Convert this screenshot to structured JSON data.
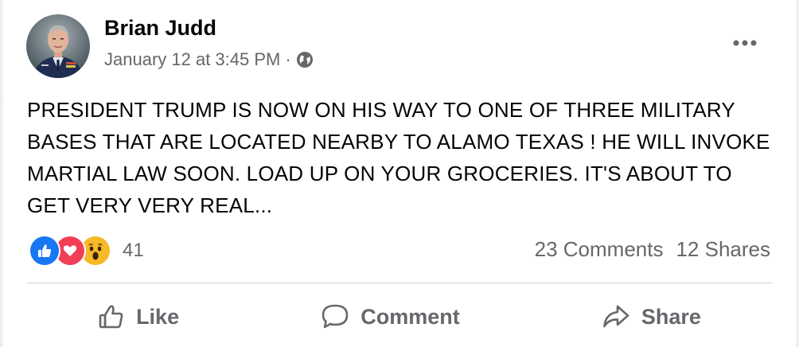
{
  "post": {
    "author": "Brian Judd",
    "timestamp": "January 12 at 3:45 PM",
    "separator": "·",
    "privacy_icon": "globe-icon",
    "more_icon": "more-options-icon",
    "text": "PRESIDENT TRUMP IS NOW ON HIS WAY TO ONE OF THREE MILITARY BASES THAT ARE LOCATED NEARBY TO ALAMO TEXAS ! HE WILL INVOKE MARTIAL LAW SOON. LOAD UP ON YOUR GROCERIES. IT'S ABOUT TO GET VERY VERY REAL..."
  },
  "reactions": {
    "types": [
      "like",
      "love",
      "wow"
    ],
    "count": "41"
  },
  "stats": {
    "comments": "23 Comments",
    "shares": "12 Shares"
  },
  "actions": {
    "like_label": "Like",
    "comment_label": "Comment",
    "share_label": "Share"
  },
  "colors": {
    "like_blue": "#1877f2",
    "love_red": "#f33e58",
    "wow_yellow": "#f7b928",
    "secondary_text": "#65676b"
  }
}
